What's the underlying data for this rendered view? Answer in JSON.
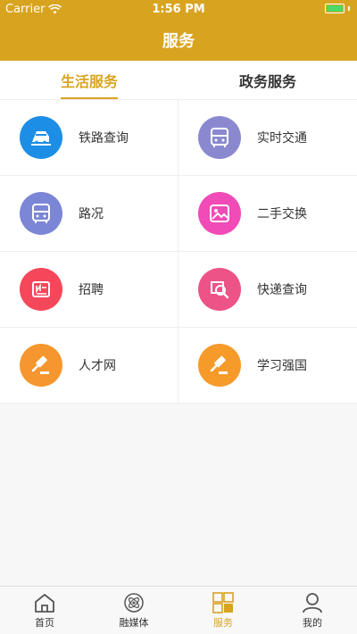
{
  "status_bar": {
    "carrier": "Carrier",
    "time": "1:56 PM"
  },
  "header": {
    "title": "服务"
  },
  "tabs": [
    {
      "label": "生活服务",
      "active": true
    },
    {
      "label": "政务服务",
      "active": false
    }
  ],
  "services": [
    {
      "label": "铁路查询",
      "icon": "train-icon",
      "color": "#1d8ee6"
    },
    {
      "label": "实时交通",
      "icon": "bus-icon",
      "color": "#8a89d0"
    },
    {
      "label": "路况",
      "icon": "bus-icon",
      "color": "#7b86d6"
    },
    {
      "label": "二手交换",
      "icon": "image-icon",
      "color": "#f04bb6"
    },
    {
      "label": "招聘",
      "icon": "newspaper-icon",
      "color": "#f5475a"
    },
    {
      "label": "快递查询",
      "icon": "package-search-icon",
      "color": "#ee5388"
    },
    {
      "label": "人才网",
      "icon": "gavel-icon",
      "color": "#f6962e"
    },
    {
      "label": "学习强国",
      "icon": "gavel-icon",
      "color": "#f69a2a"
    }
  ],
  "bottom_nav": [
    {
      "label": "首页",
      "icon": "home-icon",
      "active": false
    },
    {
      "label": "融媒体",
      "icon": "atom-icon",
      "active": false
    },
    {
      "label": "服务",
      "icon": "grid-icon",
      "active": true
    },
    {
      "label": "我的",
      "icon": "user-icon",
      "active": false
    }
  ],
  "colors": {
    "accent": "#d8a420",
    "battery": "#4cd964"
  }
}
